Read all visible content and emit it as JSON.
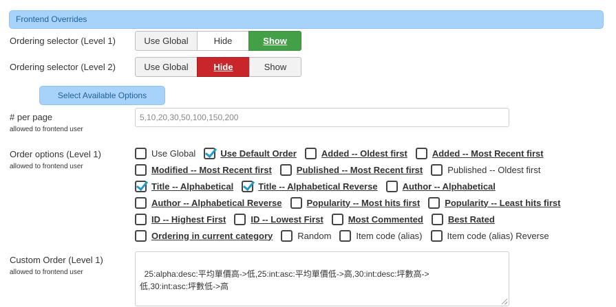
{
  "section": {
    "title": "Frontend Overrides"
  },
  "ordering_level1": {
    "label": "Ordering selector (Level 1)",
    "buttons": [
      "Use Global",
      "Hide",
      "Show"
    ],
    "selected": "Show"
  },
  "ordering_level2": {
    "label": "Ordering selector (Level 2)",
    "buttons": [
      "Use Global",
      "Hide",
      "Show"
    ],
    "selected": "Hide"
  },
  "select_options_button": "Select Available Options",
  "per_page": {
    "label": "# per page",
    "sublabel": "allowed to frontend user",
    "value": "5,10,20,30,50,100,150,200"
  },
  "order_options": {
    "label": "Order options (Level 1)",
    "sublabel": "allowed to frontend user",
    "rows": [
      [
        {
          "label": "Use Global",
          "checked": false,
          "bold": false
        },
        {
          "label": "Use Default Order",
          "checked": true,
          "bold": true
        },
        {
          "label": "Added -- Oldest first",
          "checked": false,
          "bold": true
        },
        {
          "label": "Added -- Most Recent first",
          "checked": false,
          "bold": true
        }
      ],
      [
        {
          "label": "Modified -- Most Recent first",
          "checked": false,
          "bold": true
        },
        {
          "label": "Published -- Most Recent first",
          "checked": false,
          "bold": true
        },
        {
          "label": "Published -- Oldest first",
          "checked": false,
          "bold": false
        }
      ],
      [
        {
          "label": "Title -- Alphabetical",
          "checked": true,
          "bold": true
        },
        {
          "label": "Title -- Alphabetical Reverse",
          "checked": true,
          "bold": true
        },
        {
          "label": "Author -- Alphabetical",
          "checked": false,
          "bold": true
        }
      ],
      [
        {
          "label": "Author -- Alphabetical Reverse",
          "checked": false,
          "bold": true
        },
        {
          "label": "Popularity -- Most hits first",
          "checked": false,
          "bold": true
        },
        {
          "label": "Popularity -- Least hits first",
          "checked": false,
          "bold": true
        }
      ],
      [
        {
          "label": "ID -- Highest First",
          "checked": false,
          "bold": true
        },
        {
          "label": "ID -- Lowest First",
          "checked": false,
          "bold": true
        },
        {
          "label": "Most Commented",
          "checked": false,
          "bold": true
        },
        {
          "label": "Best Rated",
          "checked": false,
          "bold": true
        }
      ],
      [
        {
          "label": "Ordering in current category",
          "checked": false,
          "bold": true
        },
        {
          "label": "Random",
          "checked": false,
          "bold": false
        },
        {
          "label": "Item code (alias)",
          "checked": false,
          "bold": false
        },
        {
          "label": "Item code (alias) Reverse",
          "checked": false,
          "bold": false
        }
      ]
    ]
  },
  "custom_order": {
    "label": "Custom Order (Level 1)",
    "sublabel": "allowed to frontend user",
    "value": "25:alpha:desc:平均單價高->低,25:int:asc:平均單價低->高,30:int:desc:坪數高->\n低,30:int:asc:坪數低->高"
  }
}
